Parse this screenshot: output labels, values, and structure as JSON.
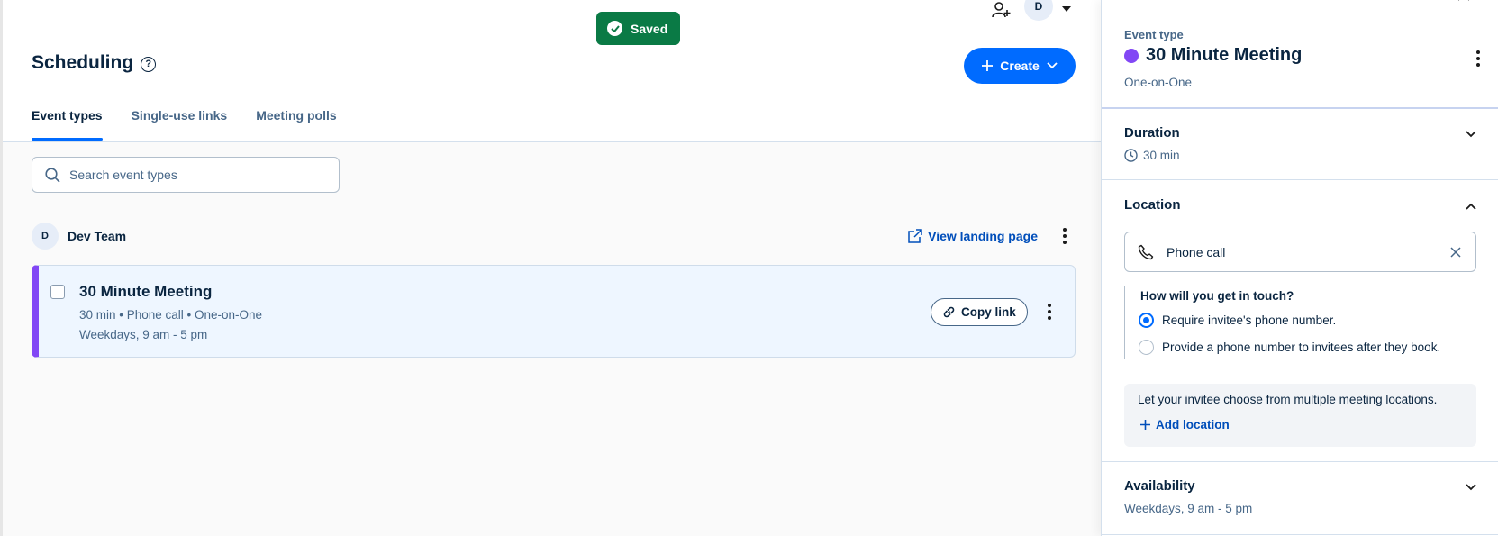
{
  "toast": {
    "text": "Saved"
  },
  "header": {
    "avatar_initial": "D"
  },
  "page": {
    "title": "Scheduling",
    "create_label": "Create",
    "tabs": [
      {
        "label": "Event types",
        "active": true
      },
      {
        "label": "Single-use links",
        "active": false
      },
      {
        "label": "Meeting polls",
        "active": false
      }
    ],
    "search_placeholder": "Search event types"
  },
  "team": {
    "initial": "D",
    "name": "Dev Team",
    "landing_label": "View landing page"
  },
  "event_card": {
    "title": "30 Minute Meeting",
    "meta": "30 min • Phone call • One-on-One",
    "hours": "Weekdays, 9 am - 5 pm",
    "copy_label": "Copy link",
    "accent_color": "#8247f5"
  },
  "panel": {
    "label": "Event type",
    "title": "30 Minute Meeting",
    "subtitle": "One-on-One",
    "dot_color": "#8247f5",
    "duration": {
      "title": "Duration",
      "value": "30 min"
    },
    "location": {
      "title": "Location",
      "value": "Phone call",
      "question": "How will you get in touch?",
      "options": [
        {
          "label": "Require invitee's phone number.",
          "selected": true
        },
        {
          "label": "Provide a phone number to invitees after they book.",
          "selected": false
        }
      ],
      "multi_text": "Let your invitee choose from multiple meeting locations.",
      "add_label": "Add location"
    },
    "availability": {
      "title": "Availability",
      "value": "Weekdays, 9 am - 5 pm"
    }
  },
  "colors": {
    "primary": "#006bff",
    "success": "#0a7a45",
    "link": "#004eba",
    "text": "#0a2540",
    "muted": "#476788"
  }
}
